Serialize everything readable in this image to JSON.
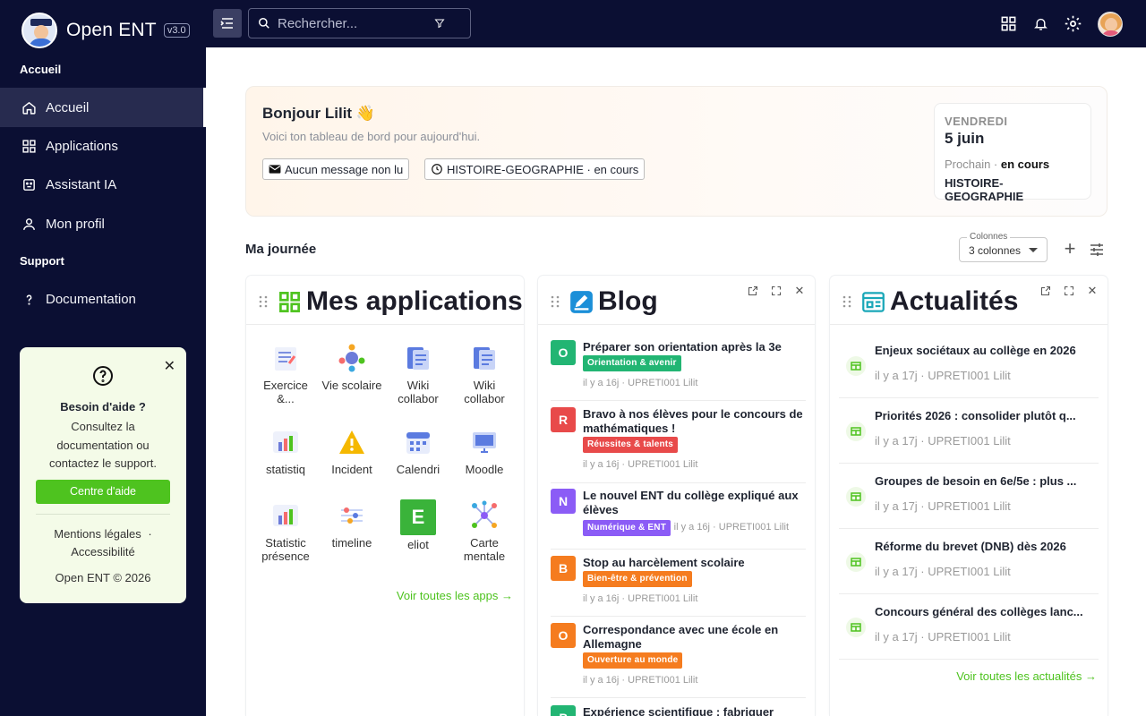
{
  "brand": {
    "name": "Open ENT",
    "version": "v3.0"
  },
  "sidebar": {
    "section1": "Accueil",
    "items": [
      {
        "label": "Accueil",
        "icon": "home-icon"
      },
      {
        "label": "Applications",
        "icon": "grid-icon"
      },
      {
        "label": "Assistant IA",
        "icon": "robot-icon"
      },
      {
        "label": "Mon profil",
        "icon": "user-icon"
      }
    ],
    "section2": "Support",
    "support_items": [
      {
        "label": "Documentation",
        "icon": "help-icon"
      }
    ]
  },
  "help_box": {
    "title": "Besoin d'aide ?",
    "text": "Consultez la documentation ou contactez le support.",
    "button": "Centre d'aide",
    "legal": "Mentions légales",
    "accessibility": "Accessibilité",
    "sep": "·",
    "copyright": "Open ENT © 2026"
  },
  "search": {
    "placeholder": "Rechercher..."
  },
  "greeting": {
    "title": "Bonjour Lilit 👋",
    "subtitle": "Voici ton tableau de bord pour aujourd'hui.",
    "chip_messages": "Aucun message non lu",
    "chip_course": "HISTOIRE-GEOGRAPHIE · en cours"
  },
  "day_card": {
    "weekday": "VENDREDI",
    "date": "5 juin",
    "next_label": "Prochain ·",
    "next_value": "en cours",
    "course": "HISTOIRE-GEOGRAPHIE"
  },
  "my_day": {
    "title": "Ma journée",
    "columns_label": "Colonnes",
    "columns_value": "3 colonnes"
  },
  "apps_card": {
    "title": "Mes applications",
    "more": "Voir toutes les apps →",
    "apps": [
      {
        "label": "Exercice &...",
        "icon": "exercise-icon"
      },
      {
        "label": "Vie scolaire",
        "icon": "school-life-icon"
      },
      {
        "label": "Wiki collabor",
        "icon": "wiki-icon"
      },
      {
        "label": "Wiki collabor",
        "icon": "wiki-icon"
      },
      {
        "label": "statistiq",
        "icon": "stats-icon"
      },
      {
        "label": "Incident",
        "icon": "warning-icon"
      },
      {
        "label": "Calendri",
        "icon": "calendar-icon"
      },
      {
        "label": "Moodle",
        "icon": "moodle-icon"
      },
      {
        "label": "Statistic présence",
        "icon": "stats-icon"
      },
      {
        "label": "timeline",
        "icon": "timeline-icon"
      },
      {
        "label": "eliot",
        "icon": "eliot-icon",
        "letter": "E"
      },
      {
        "label": "Carte mentale",
        "icon": "mindmap-icon"
      }
    ]
  },
  "blog_card": {
    "title": "Blog",
    "posts": [
      {
        "letter": "O",
        "title": "Préparer son orientation après la 3e",
        "tag": "Orientation & avenir",
        "meta": "il y a 16j · UPRETI001 Lilit",
        "color": "#22b573",
        "tagcolor": "#22b573"
      },
      {
        "letter": "R",
        "title": "Bravo à nos élèves pour le concours de mathématiques !",
        "tag": "Réussites & talents",
        "meta": "il y a 16j · UPRETI001 Lilit",
        "color": "#e84a4a",
        "tagcolor": "#e84a4a"
      },
      {
        "letter": "N",
        "title": "Le nouvel ENT du collège expliqué aux élèves",
        "tag": "Numérique & ENT",
        "meta": "il y a 16j · UPRETI001 Lilit",
        "color": "#8b5cf6",
        "tagcolor": "#8b5cf6"
      },
      {
        "letter": "B",
        "title": "Stop au harcèlement scolaire",
        "tag": "Bien-être & prévention",
        "meta": "il y a 16j · UPRETI001 Lilit",
        "color": "#f57c1f",
        "tagcolor": "#f57c1f"
      },
      {
        "letter": "O",
        "title": "Correspondance avec une école en Allemagne",
        "tag": "Ouverture au monde",
        "meta": "il y a 16j · UPRETI001 Lilit",
        "color": "#f57c1f",
        "tagcolor": "#f57c1f"
      },
      {
        "letter": "P",
        "title": "Expérience scientifique : fabriquer",
        "tag": "",
        "meta": "",
        "color": "#22b573",
        "tagcolor": "#22b573"
      }
    ]
  },
  "news_card": {
    "title": "Actualités",
    "more": "Voir toutes les actualités →",
    "items": [
      {
        "title": "Enjeux sociétaux au collège en 2026",
        "meta": "il y a 17j · UPRETI001 Lilit"
      },
      {
        "title": "Priorités 2026 : consolider plutôt q...",
        "meta": "il y a 17j · UPRETI001 Lilit"
      },
      {
        "title": "Groupes de besoin en 6e/5e : plus ...",
        "meta": "il y a 17j · UPRETI001 Lilit"
      },
      {
        "title": "Réforme du brevet (DNB) dès 2026",
        "meta": "il y a 17j · UPRETI001 Lilit"
      },
      {
        "title": "Concours général des collèges lanc...",
        "meta": "il y a 17j · UPRETI001 Lilit"
      }
    ]
  },
  "colors": {
    "sidebar": "#0b0f33",
    "accent": "#4ec31f",
    "active": "#272b4f"
  }
}
